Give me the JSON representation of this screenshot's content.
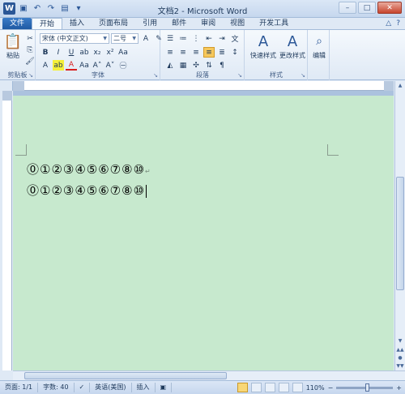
{
  "window": {
    "title": "文档2 - Microsoft Word"
  },
  "tabs": {
    "file": "文件",
    "items": [
      "开始",
      "插入",
      "页面布局",
      "引用",
      "邮件",
      "审阅",
      "视图",
      "开发工具"
    ]
  },
  "ribbon": {
    "clipboard": {
      "label": "剪贴板",
      "paste": "粘贴"
    },
    "font": {
      "label": "字体",
      "font_name": "宋体 (中文正文)",
      "font_size": "二号"
    },
    "paragraph": {
      "label": "段落"
    },
    "styles": {
      "label": "样式",
      "quick_styles": "快速样式",
      "change_styles": "更改样式"
    },
    "editing": {
      "label": "编辑"
    }
  },
  "document": {
    "line1": "⓪①②③④⑤⑥⑦⑧⑩",
    "line2": "⓪①②③④⑤⑥⑦⑧⑩",
    "paragraph_mark": "↵"
  },
  "status": {
    "page": "页面: 1/1",
    "words": "字数: 40",
    "language": "英语(美国)",
    "mode": "插入",
    "zoom": "110%"
  },
  "colors": {
    "page_background": "#c7e9ce",
    "file_tab": "#2b5797"
  }
}
